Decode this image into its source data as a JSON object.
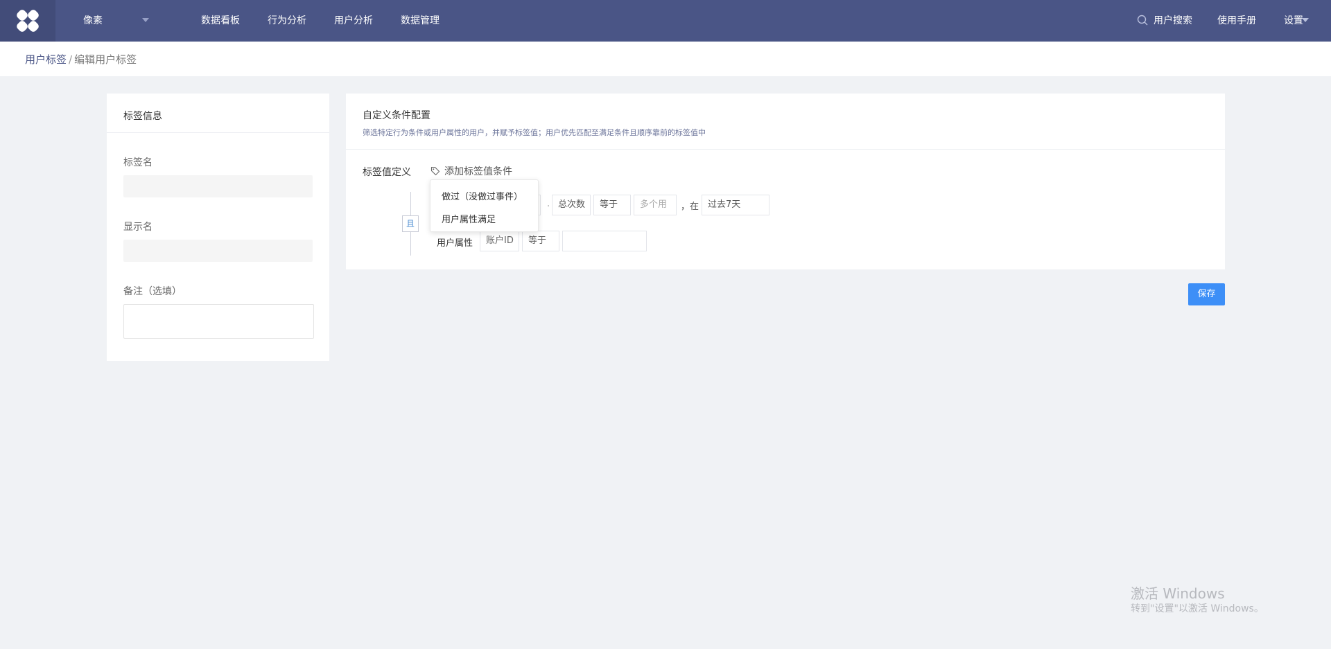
{
  "nav": {
    "project": "像素",
    "items": [
      "数据看板",
      "行为分析",
      "用户分析",
      "数据管理"
    ],
    "user_search": "用户搜索",
    "manual": "使用手册",
    "settings": "设置"
  },
  "breadcrumb": {
    "parent": "用户标签",
    "separator": "/",
    "current": "编辑用户标签"
  },
  "left_panel": {
    "title": "标签信息",
    "tag_name_label": "标签名",
    "tag_name_value": "",
    "display_name_label": "显示名",
    "display_name_value": "",
    "note_label": "备注（选填）",
    "note_value": ""
  },
  "right_panel": {
    "title": "自定义条件配置",
    "description": "筛选特定行为条件或用户属性的用户，并赋予标签值；用户优先匹配至满足条件且顺序靠前的标签值中",
    "definition_label": "标签值定义",
    "add_condition": "添加标签值条件",
    "and_label": "且",
    "row1": {
      "dot": ".",
      "metric": "总次数",
      "operator": "等于",
      "value_placeholder": "多个用",
      "comma_in": "，在",
      "time_range": "过去7天"
    },
    "row2": {
      "label": "用户属性",
      "property": "账户ID",
      "operator": "等于",
      "value": ""
    }
  },
  "dropdown": {
    "items": [
      "做过（没做过事件）",
      "用户属性满足"
    ]
  },
  "save_label": "保存",
  "watermark": {
    "line1": "激活 Windows",
    "line2": "转到\"设置\"以激活 Windows。"
  }
}
